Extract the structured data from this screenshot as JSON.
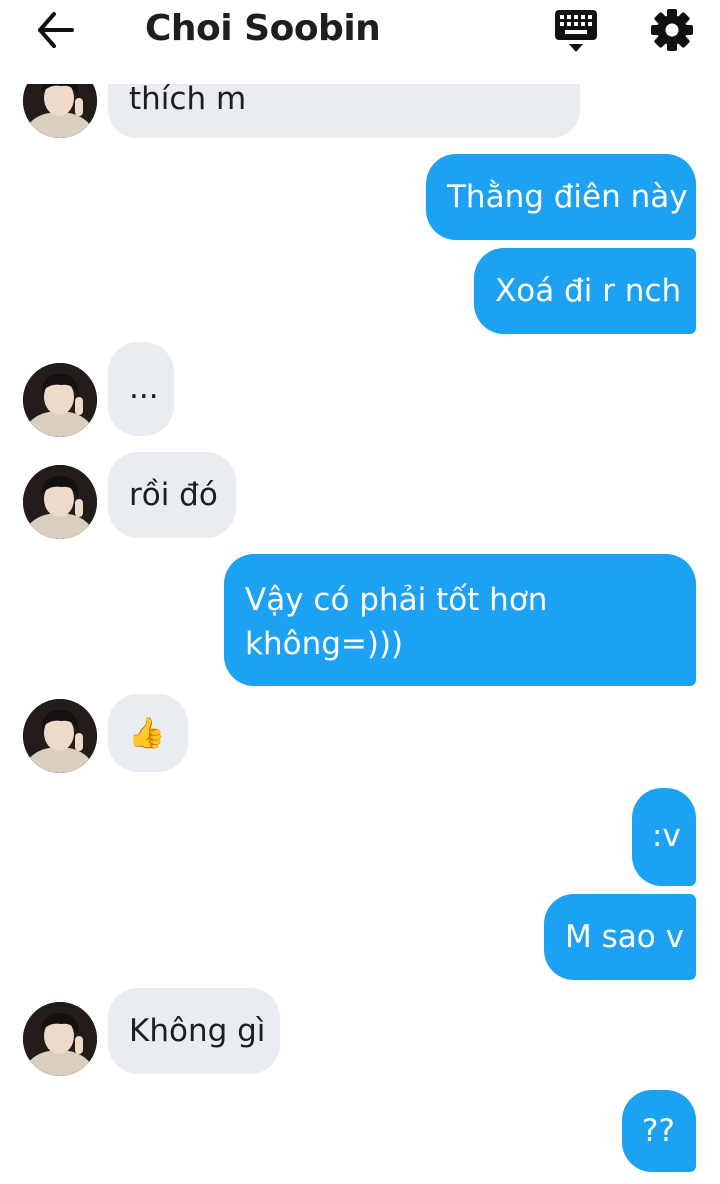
{
  "header": {
    "title": "Choi Soobin",
    "back_icon": "arrow-left-icon",
    "keyboard_icon": "keyboard-icon",
    "settings_icon": "gear-icon"
  },
  "colors": {
    "outgoing_bubble": "#1da1f2",
    "incoming_bubble": "#e9ecf0",
    "text_dark": "#1c1e21"
  },
  "messages": [
    {
      "from": "contact",
      "text": "thích m"
    },
    {
      "from": "me",
      "text": "Thằng điên này"
    },
    {
      "from": "me",
      "text": "Xoá đi r nch"
    },
    {
      "from": "contact",
      "text": "..."
    },
    {
      "from": "contact",
      "text": "rồi đó"
    },
    {
      "from": "me",
      "text_line1": "Vậy có phải tốt hơn",
      "text_line2": "không=)))"
    },
    {
      "from": "contact",
      "text": "👍"
    },
    {
      "from": "me",
      "text": ":v"
    },
    {
      "from": "me",
      "text": "M sao v"
    },
    {
      "from": "contact",
      "text": "Không gì"
    },
    {
      "from": "me",
      "text": "??"
    }
  ]
}
